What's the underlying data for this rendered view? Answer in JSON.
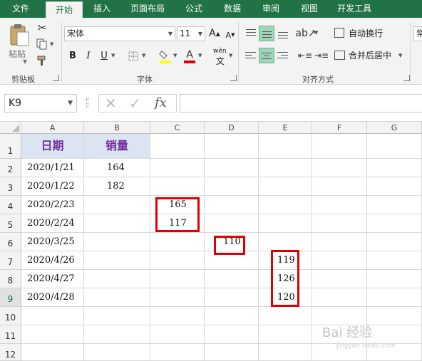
{
  "tabs": [
    "文件",
    "开始",
    "插入",
    "页面布局",
    "公式",
    "数据",
    "审阅",
    "视图",
    "开发工具"
  ],
  "ribbon": {
    "clipboard": {
      "label": "剪贴板",
      "paste": "粘贴"
    },
    "font": {
      "label": "字体",
      "font_name": "宋体",
      "font_size": "11",
      "bold": "B",
      "italic": "I",
      "underline": "U",
      "grow": "A",
      "shrink": "A",
      "font_color": "A",
      "phonetic": "wén"
    },
    "alignment": {
      "label": "对齐方式",
      "wrap": "自动换行",
      "merge": "合并后居中"
    },
    "number_partial": "常"
  },
  "formula_bar": {
    "name_box": "K9",
    "fx": "fx",
    "formula": ""
  },
  "columns": [
    "A",
    "B",
    "C",
    "D",
    "E",
    "F",
    "G"
  ],
  "rows": [
    "1",
    "2",
    "3",
    "4",
    "5",
    "6",
    "7",
    "8",
    "9",
    "10",
    "11",
    "12"
  ],
  "table": {
    "header_a": "日期",
    "header_b": "销量",
    "dates": [
      "2020/1/21",
      "2020/1/22",
      "2020/2/23",
      "2020/2/24",
      "2020/3/25",
      "2020/4/26",
      "2020/4/27",
      "2020/4/28"
    ],
    "b_values": [
      "164",
      "182"
    ],
    "c_values": [
      "165",
      "117"
    ],
    "d_values": [
      "110"
    ],
    "e_values": [
      "119",
      "126",
      "120"
    ]
  },
  "watermark": {
    "text": "Bai 经验",
    "sub": "jingyan.baidu.com"
  },
  "colors": {
    "accent": "#217346",
    "highlight": "#e00000",
    "header_fill": "#dbe4f0",
    "header_text": "#7030a0"
  }
}
